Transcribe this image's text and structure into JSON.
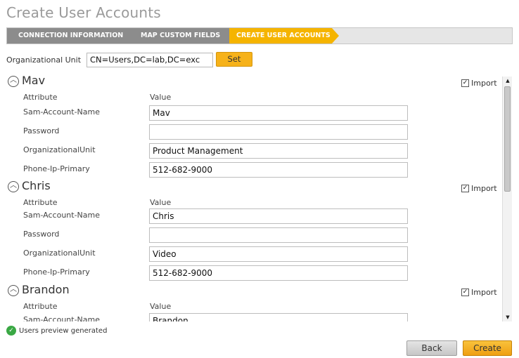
{
  "title": "Create User Accounts",
  "wizard": {
    "steps": [
      {
        "label": "Connection Information"
      },
      {
        "label": "Map Custom Fields"
      },
      {
        "label": "Create User Accounts"
      }
    ]
  },
  "ou": {
    "label": "Organizational Unit",
    "value": "CN=Users,DC=lab,DC=exc",
    "set_label": "Set"
  },
  "columns": {
    "attribute": "Attribute",
    "value": "Value"
  },
  "import_label": "Import",
  "users": [
    {
      "name": "Mav",
      "imported": true,
      "rows": [
        {
          "attribute": "Sam-Account-Name",
          "value": "Mav"
        },
        {
          "attribute": "Password",
          "value": ""
        },
        {
          "attribute": "OrganizationalUnit",
          "value": "Product Management"
        },
        {
          "attribute": "Phone-Ip-Primary",
          "value": "512-682-9000"
        }
      ]
    },
    {
      "name": "Chris",
      "imported": true,
      "rows": [
        {
          "attribute": "Sam-Account-Name",
          "value": "Chris"
        },
        {
          "attribute": "Password",
          "value": ""
        },
        {
          "attribute": "OrganizationalUnit",
          "value": "Video"
        },
        {
          "attribute": "Phone-Ip-Primary",
          "value": "512-682-9000"
        }
      ]
    },
    {
      "name": "Brandon",
      "imported": true,
      "rows": [
        {
          "attribute": "Sam-Account-Name",
          "value": "Brandon"
        }
      ]
    }
  ],
  "status": {
    "text": "Users preview generated",
    "icon": "check-circle-icon",
    "color": "#3aa844"
  },
  "footer": {
    "back_label": "Back",
    "create_label": "Create"
  },
  "colors": {
    "accent": "#f5b400",
    "step_inactive": "#8c8c8c"
  }
}
